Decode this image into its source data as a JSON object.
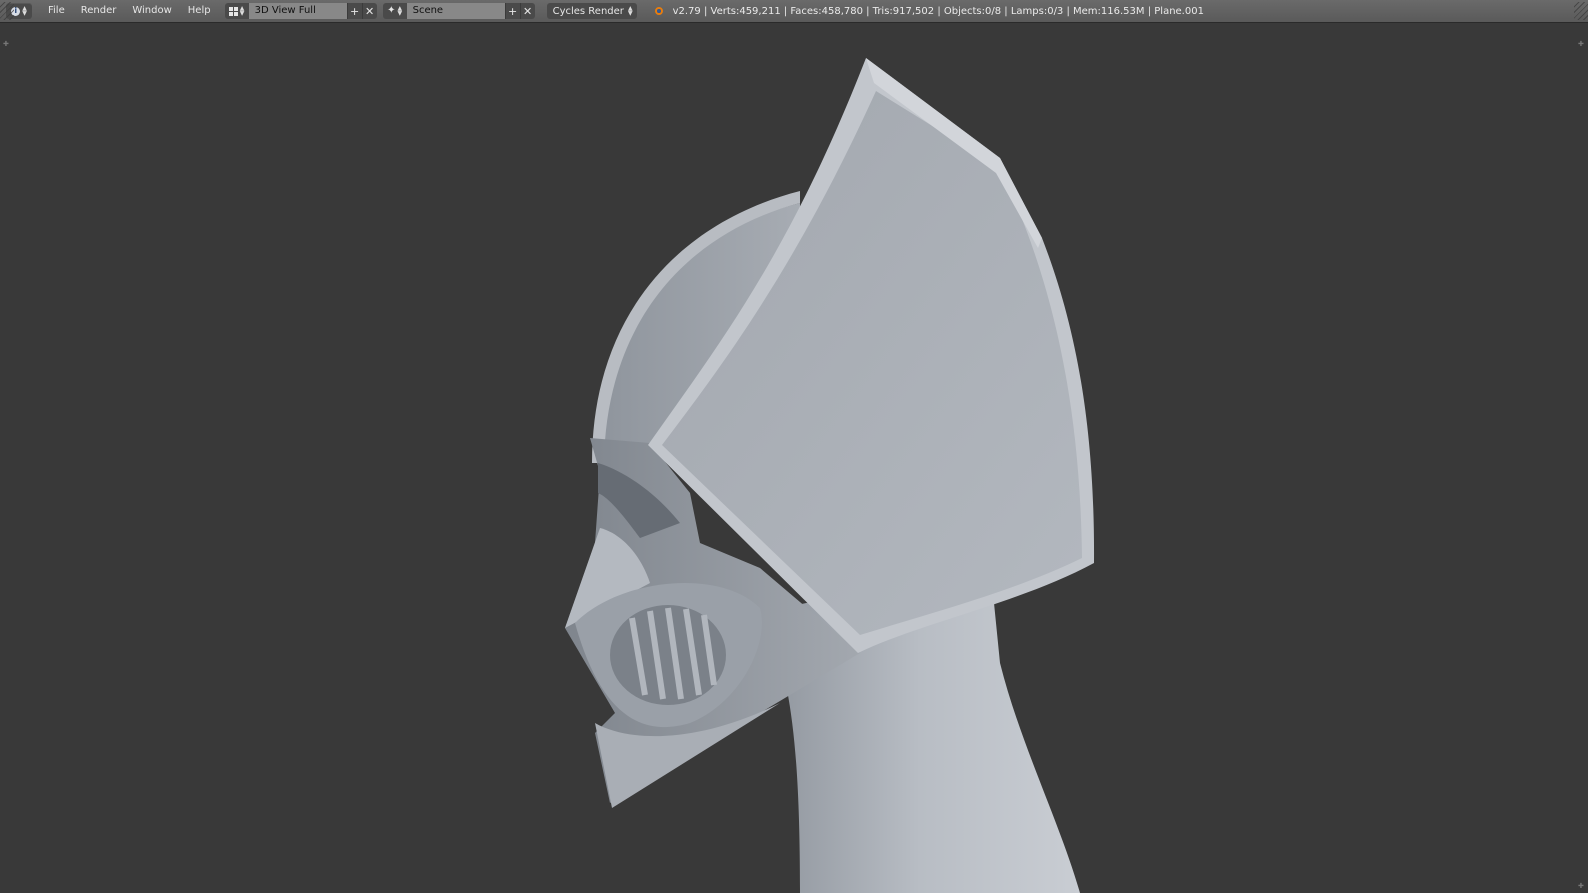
{
  "header": {
    "editor_type_icon": "info-icon",
    "menu": [
      "File",
      "Render",
      "Window",
      "Help"
    ],
    "screen_layout": {
      "icon": "screen-layout-grid-icon",
      "value": "3D View Full"
    },
    "scene": {
      "icon": "scene-icon",
      "value": "Scene"
    },
    "render_engine": "Cycles Render",
    "stats_icon": "blender-logo-icon",
    "stats": "v2.79 | Verts:459,211 | Faces:458,780 | Tris:917,502 | Objects:0/8 | Lamps:0/3 | Mem:116.53M | Plane.001"
  },
  "viewport": {
    "background_color": "#393939",
    "model_description_icon": "helmet-render"
  },
  "colors": {
    "header_bg": "#5f5f5f",
    "field_bg": "#888888",
    "button_bg": "#4a4a4a",
    "text": "#e6e6e6",
    "model_gray": "#a6abb3"
  }
}
